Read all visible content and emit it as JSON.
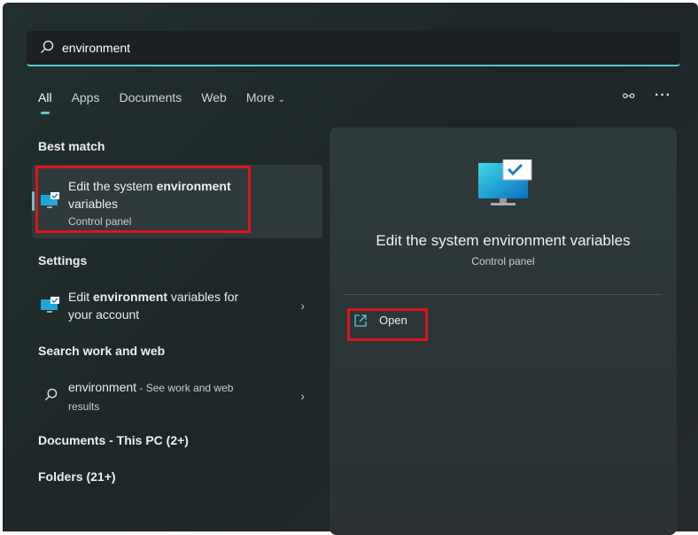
{
  "search": {
    "value": "environment"
  },
  "tabs": [
    {
      "label": "All"
    },
    {
      "label": "Apps"
    },
    {
      "label": "Documents"
    },
    {
      "label": "Web"
    },
    {
      "label": "More"
    }
  ],
  "best_match": {
    "heading": "Best match",
    "title_pre": "Edit the system ",
    "title_bold": "environment",
    "title_post": " variables",
    "subtitle": "Control panel"
  },
  "settings": {
    "heading": "Settings",
    "pre": "Edit ",
    "bold": "environment",
    "post": " variables for your account"
  },
  "web": {
    "heading": "Search work and web",
    "query": "environment",
    "suffix": " - See work and web results"
  },
  "documents": {
    "heading": "Documents - This PC (2+)"
  },
  "folders": {
    "heading": "Folders (21+)"
  },
  "preview": {
    "title": "Edit the system environment variables",
    "subtitle": "Control panel",
    "open_label": "Open"
  },
  "colors": {
    "accent": "#5fc9cf",
    "highlight": "#e0141c"
  }
}
